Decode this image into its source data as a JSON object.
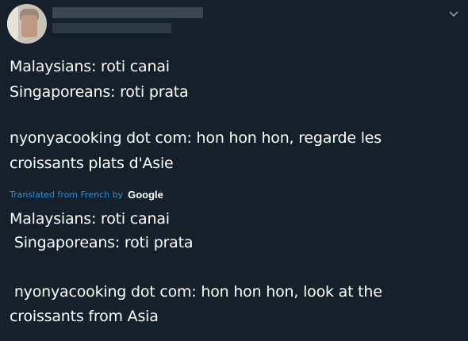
{
  "header": {
    "chevron_icon": "chevron-down-icon"
  },
  "original_text": {
    "lines": [
      "Malaysians: roti canai",
      "Singaporeans: roti prata",
      "",
      "nyonyacooking dot com: hon hon hon, regarde les",
      "croissants plats d'Asie"
    ]
  },
  "translation": {
    "label": "Translated from French by",
    "provider": "Google",
    "lines": [
      "Malaysians: roti canai",
      " Singaporeans: roti prata",
      "",
      " nyonyacooking dot com: hon hon hon, look at the",
      "croissants from Asia"
    ]
  },
  "colors": {
    "background": "#15202b",
    "text": "#ffffff",
    "link": "#1b95e0"
  }
}
